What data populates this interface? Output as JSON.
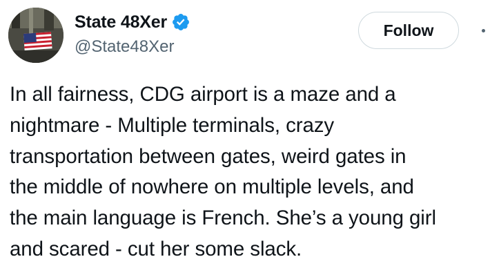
{
  "author": {
    "display_name": "State 48Xer",
    "handle": "@State48Xer",
    "verified": true,
    "avatar_icon": "avatar-flag-photo-icon"
  },
  "actions": {
    "follow_label": "Follow",
    "more_icon": "more-options-icon"
  },
  "tweet": {
    "lines": [
      "In all fairness, CDG airport is a maze and a",
      "nightmare - Multiple terminals, crazy",
      "transportation between gates, weird gates in",
      "the middle of nowhere on multiple levels, and",
      "the main language is French. She’s a young girl",
      "and scared - cut her some slack."
    ]
  },
  "colors": {
    "text_primary": "#0f1419",
    "text_secondary": "#536471",
    "verified_blue": "#1d9bf0",
    "button_border": "#cfd9de"
  }
}
